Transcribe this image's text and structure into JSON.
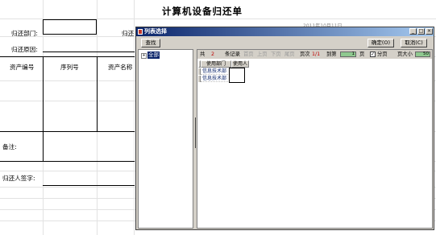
{
  "form": {
    "title": "计算机设备归还单",
    "date_fragment": "2011年10月11日",
    "return_dept_label": "归还部门:",
    "return_person_label_partial": "归还",
    "return_reason_label": "归还原因:",
    "columns": [
      "资产编号",
      "序列号",
      "资产名称"
    ],
    "remarks_label": "备注:",
    "signature_label": "归还人签字:"
  },
  "dialog": {
    "title": "列表选择",
    "search_button": "查找",
    "ok_button": "确定(O)",
    "cancel_button": "取消(C)",
    "window_buttons": {
      "minimize": "_",
      "maximize": "□",
      "close": "×"
    },
    "tree": {
      "expander": "+",
      "root": "全部"
    },
    "pager": {
      "total_prefix": "共",
      "total_count": "2",
      "total_suffix": "条记录",
      "first": "首页",
      "prev": "上页",
      "next": "下页",
      "last": "尾页",
      "page_label": "页次",
      "page_value": "1/1",
      "goto_label": "到第",
      "goto_value": "1",
      "page_unit": "页",
      "paging_checked": true,
      "paging_label": "分页",
      "page_size_label": "页大小",
      "page_size_value": "50"
    },
    "grid": {
      "headers": [
        "使用部门",
        "使用人"
      ],
      "rows": [
        {
          "dept": "信息技术部",
          "user": ""
        },
        {
          "dept": "信息技术部",
          "user": ""
        }
      ]
    }
  }
}
